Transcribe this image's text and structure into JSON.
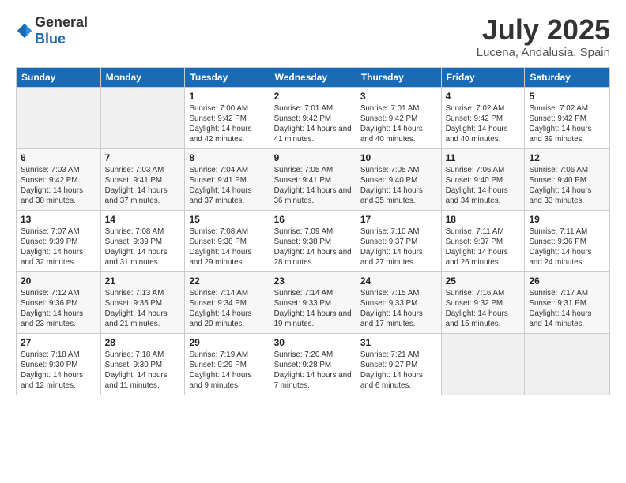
{
  "header": {
    "logo_general": "General",
    "logo_blue": "Blue",
    "title": "July 2025",
    "subtitle": "Lucena, Andalusia, Spain"
  },
  "days_of_week": [
    "Sunday",
    "Monday",
    "Tuesday",
    "Wednesday",
    "Thursday",
    "Friday",
    "Saturday"
  ],
  "weeks": [
    [
      {
        "day": "",
        "sunrise": "",
        "sunset": "",
        "daylight": ""
      },
      {
        "day": "",
        "sunrise": "",
        "sunset": "",
        "daylight": ""
      },
      {
        "day": "1",
        "sunrise": "Sunrise: 7:00 AM",
        "sunset": "Sunset: 9:42 PM",
        "daylight": "Daylight: 14 hours and 42 minutes."
      },
      {
        "day": "2",
        "sunrise": "Sunrise: 7:01 AM",
        "sunset": "Sunset: 9:42 PM",
        "daylight": "Daylight: 14 hours and 41 minutes."
      },
      {
        "day": "3",
        "sunrise": "Sunrise: 7:01 AM",
        "sunset": "Sunset: 9:42 PM",
        "daylight": "Daylight: 14 hours and 40 minutes."
      },
      {
        "day": "4",
        "sunrise": "Sunrise: 7:02 AM",
        "sunset": "Sunset: 9:42 PM",
        "daylight": "Daylight: 14 hours and 40 minutes."
      },
      {
        "day": "5",
        "sunrise": "Sunrise: 7:02 AM",
        "sunset": "Sunset: 9:42 PM",
        "daylight": "Daylight: 14 hours and 39 minutes."
      }
    ],
    [
      {
        "day": "6",
        "sunrise": "Sunrise: 7:03 AM",
        "sunset": "Sunset: 9:42 PM",
        "daylight": "Daylight: 14 hours and 38 minutes."
      },
      {
        "day": "7",
        "sunrise": "Sunrise: 7:03 AM",
        "sunset": "Sunset: 9:41 PM",
        "daylight": "Daylight: 14 hours and 37 minutes."
      },
      {
        "day": "8",
        "sunrise": "Sunrise: 7:04 AM",
        "sunset": "Sunset: 9:41 PM",
        "daylight": "Daylight: 14 hours and 37 minutes."
      },
      {
        "day": "9",
        "sunrise": "Sunrise: 7:05 AM",
        "sunset": "Sunset: 9:41 PM",
        "daylight": "Daylight: 14 hours and 36 minutes."
      },
      {
        "day": "10",
        "sunrise": "Sunrise: 7:05 AM",
        "sunset": "Sunset: 9:40 PM",
        "daylight": "Daylight: 14 hours and 35 minutes."
      },
      {
        "day": "11",
        "sunrise": "Sunrise: 7:06 AM",
        "sunset": "Sunset: 9:40 PM",
        "daylight": "Daylight: 14 hours and 34 minutes."
      },
      {
        "day": "12",
        "sunrise": "Sunrise: 7:06 AM",
        "sunset": "Sunset: 9:40 PM",
        "daylight": "Daylight: 14 hours and 33 minutes."
      }
    ],
    [
      {
        "day": "13",
        "sunrise": "Sunrise: 7:07 AM",
        "sunset": "Sunset: 9:39 PM",
        "daylight": "Daylight: 14 hours and 32 minutes."
      },
      {
        "day": "14",
        "sunrise": "Sunrise: 7:08 AM",
        "sunset": "Sunset: 9:39 PM",
        "daylight": "Daylight: 14 hours and 31 minutes."
      },
      {
        "day": "15",
        "sunrise": "Sunrise: 7:08 AM",
        "sunset": "Sunset: 9:38 PM",
        "daylight": "Daylight: 14 hours and 29 minutes."
      },
      {
        "day": "16",
        "sunrise": "Sunrise: 7:09 AM",
        "sunset": "Sunset: 9:38 PM",
        "daylight": "Daylight: 14 hours and 28 minutes."
      },
      {
        "day": "17",
        "sunrise": "Sunrise: 7:10 AM",
        "sunset": "Sunset: 9:37 PM",
        "daylight": "Daylight: 14 hours and 27 minutes."
      },
      {
        "day": "18",
        "sunrise": "Sunrise: 7:11 AM",
        "sunset": "Sunset: 9:37 PM",
        "daylight": "Daylight: 14 hours and 26 minutes."
      },
      {
        "day": "19",
        "sunrise": "Sunrise: 7:11 AM",
        "sunset": "Sunset: 9:36 PM",
        "daylight": "Daylight: 14 hours and 24 minutes."
      }
    ],
    [
      {
        "day": "20",
        "sunrise": "Sunrise: 7:12 AM",
        "sunset": "Sunset: 9:36 PM",
        "daylight": "Daylight: 14 hours and 23 minutes."
      },
      {
        "day": "21",
        "sunrise": "Sunrise: 7:13 AM",
        "sunset": "Sunset: 9:35 PM",
        "daylight": "Daylight: 14 hours and 21 minutes."
      },
      {
        "day": "22",
        "sunrise": "Sunrise: 7:14 AM",
        "sunset": "Sunset: 9:34 PM",
        "daylight": "Daylight: 14 hours and 20 minutes."
      },
      {
        "day": "23",
        "sunrise": "Sunrise: 7:14 AM",
        "sunset": "Sunset: 9:33 PM",
        "daylight": "Daylight: 14 hours and 19 minutes."
      },
      {
        "day": "24",
        "sunrise": "Sunrise: 7:15 AM",
        "sunset": "Sunset: 9:33 PM",
        "daylight": "Daylight: 14 hours and 17 minutes."
      },
      {
        "day": "25",
        "sunrise": "Sunrise: 7:16 AM",
        "sunset": "Sunset: 9:32 PM",
        "daylight": "Daylight: 14 hours and 15 minutes."
      },
      {
        "day": "26",
        "sunrise": "Sunrise: 7:17 AM",
        "sunset": "Sunset: 9:31 PM",
        "daylight": "Daylight: 14 hours and 14 minutes."
      }
    ],
    [
      {
        "day": "27",
        "sunrise": "Sunrise: 7:18 AM",
        "sunset": "Sunset: 9:30 PM",
        "daylight": "Daylight: 14 hours and 12 minutes."
      },
      {
        "day": "28",
        "sunrise": "Sunrise: 7:18 AM",
        "sunset": "Sunset: 9:30 PM",
        "daylight": "Daylight: 14 hours and 11 minutes."
      },
      {
        "day": "29",
        "sunrise": "Sunrise: 7:19 AM",
        "sunset": "Sunset: 9:29 PM",
        "daylight": "Daylight: 14 hours and 9 minutes."
      },
      {
        "day": "30",
        "sunrise": "Sunrise: 7:20 AM",
        "sunset": "Sunset: 9:28 PM",
        "daylight": "Daylight: 14 hours and 7 minutes."
      },
      {
        "day": "31",
        "sunrise": "Sunrise: 7:21 AM",
        "sunset": "Sunset: 9:27 PM",
        "daylight": "Daylight: 14 hours and 6 minutes."
      },
      {
        "day": "",
        "sunrise": "",
        "sunset": "",
        "daylight": ""
      },
      {
        "day": "",
        "sunrise": "",
        "sunset": "",
        "daylight": ""
      }
    ]
  ]
}
